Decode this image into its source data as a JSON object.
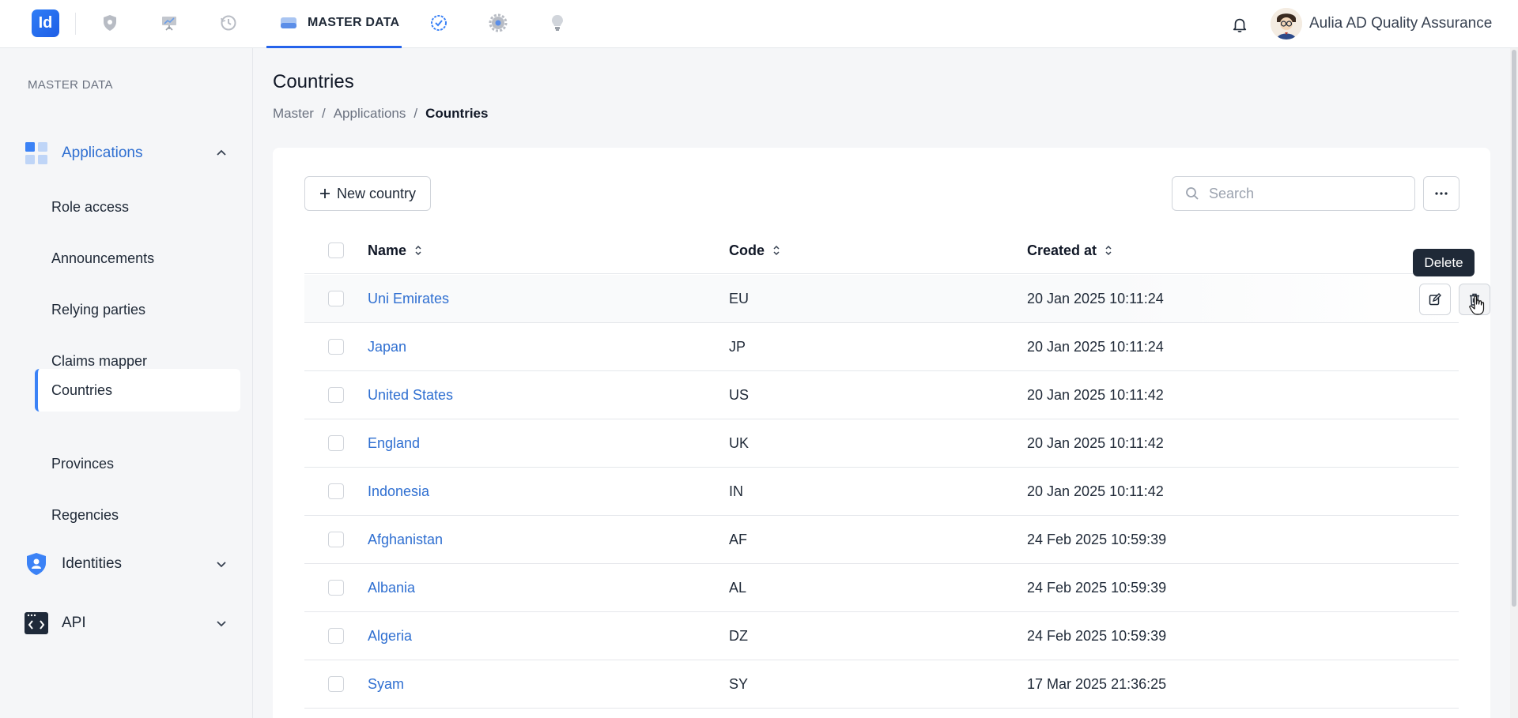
{
  "topbar": {
    "logo_text": "Id",
    "active_tab_label": "MASTER DATA",
    "nav_icons": [
      "shield-icon",
      "presentation-icon",
      "history-icon",
      "database-icon",
      "badge-check-icon",
      "gear-icon",
      "lightbulb-icon"
    ],
    "user_name": "Aulia AD Quality Assurance"
  },
  "sidebar": {
    "title": "MASTER DATA",
    "groups": [
      {
        "label": "Applications",
        "expanded": true
      },
      {
        "label": "Identities",
        "expanded": false
      },
      {
        "label": "API",
        "expanded": false
      }
    ],
    "items": [
      {
        "label": "Role access"
      },
      {
        "label": "Announcements"
      },
      {
        "label": "Relying parties"
      },
      {
        "label": "Claims mapper"
      },
      {
        "label": "Countries",
        "active": true
      },
      {
        "label": "Provinces"
      },
      {
        "label": "Regencies"
      }
    ]
  },
  "page": {
    "title": "Countries",
    "breadcrumb": [
      "Master",
      "Applications",
      "Countries"
    ]
  },
  "toolbar": {
    "new_label": "New country",
    "search_placeholder": "Search"
  },
  "table": {
    "columns": [
      "Name",
      "Code",
      "Created at"
    ],
    "rows": [
      {
        "name": "Uni Emirates",
        "code": "EU",
        "created": "20 Jan 2025 10:11:24"
      },
      {
        "name": "Japan",
        "code": "JP",
        "created": "20 Jan 2025 10:11:24"
      },
      {
        "name": "United States",
        "code": "US",
        "created": "20 Jan 2025 10:11:42"
      },
      {
        "name": "England",
        "code": "UK",
        "created": "20 Jan 2025 10:11:42"
      },
      {
        "name": "Indonesia",
        "code": "IN",
        "created": "20 Jan 2025 10:11:42"
      },
      {
        "name": "Afghanistan",
        "code": "AF",
        "created": "24 Feb 2025 10:59:39"
      },
      {
        "name": "Albania",
        "code": "AL",
        "created": "24 Feb 2025 10:59:39"
      },
      {
        "name": "Algeria",
        "code": "DZ",
        "created": "24 Feb 2025 10:59:39"
      },
      {
        "name": "Syam",
        "code": "SY",
        "created": "17 Mar 2025 21:36:25"
      }
    ]
  },
  "tooltip": {
    "text": "Delete"
  },
  "colors": {
    "accent": "#2563eb",
    "link": "#2f6fd1",
    "tooltip_bg": "#1f2937"
  }
}
